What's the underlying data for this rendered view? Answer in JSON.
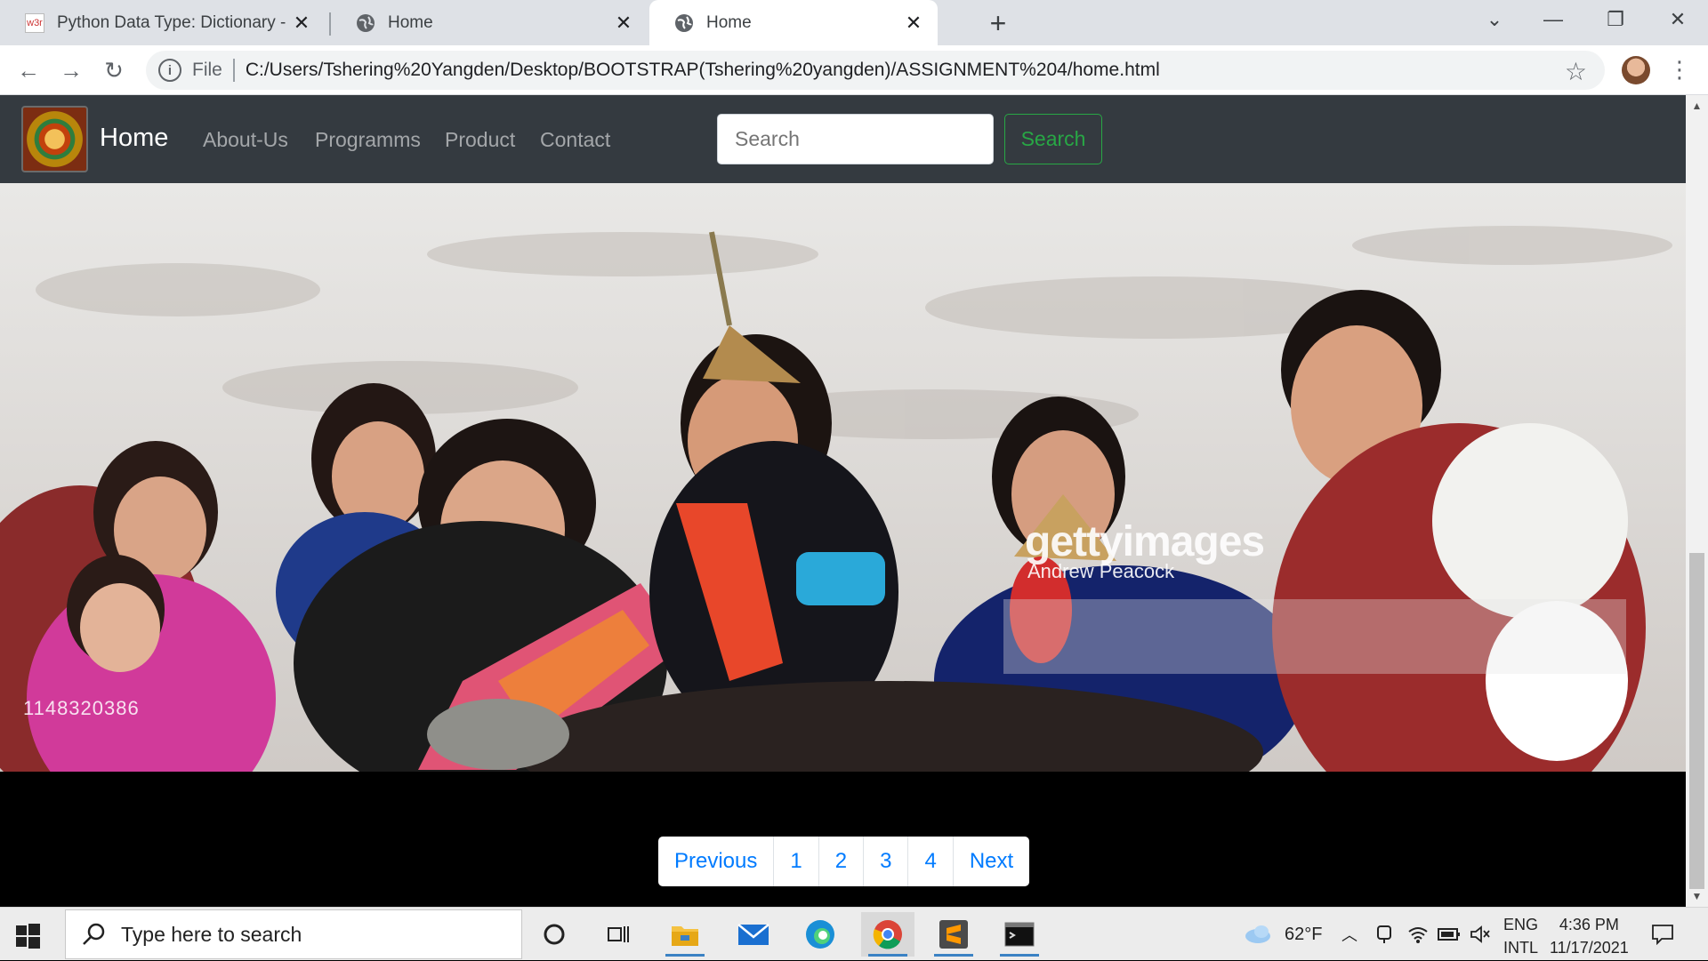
{
  "browser": {
    "tabs": [
      {
        "title": "Python Data Type: Dictionary - Exercises",
        "favicon": "w3r",
        "active": false
      },
      {
        "title": "Home",
        "favicon": "globe-icon",
        "active": false
      },
      {
        "title": "Home",
        "favicon": "globe-icon",
        "active": true
      }
    ],
    "address": {
      "scheme_label": "File",
      "url": "C:/Users/Tshering%20Yangden/Desktop/BOOTSTRAP(Tshering%20yangden)/ASSIGNMENT%204/home.html"
    }
  },
  "site": {
    "brand": "Home",
    "nav": [
      "About-Us",
      "Programms",
      "Product",
      "Contact"
    ],
    "search": {
      "placeholder": "Search",
      "button": "Search"
    },
    "hero": {
      "watermark": "gettyimages",
      "credit": "Andrew Peacock",
      "photo_id": "1148320386"
    },
    "pagination": [
      "Previous",
      "1",
      "2",
      "3",
      "4",
      "Next"
    ]
  },
  "taskbar": {
    "search_placeholder": "Type here to search",
    "weather": "62°F",
    "lang_top": "ENG",
    "lang_bottom": "INTL",
    "time": "4:36 PM",
    "date": "11/17/2021"
  },
  "colors": {
    "navbar": "#343a40",
    "search_button": "#28a745",
    "page_link": "#007bff"
  }
}
